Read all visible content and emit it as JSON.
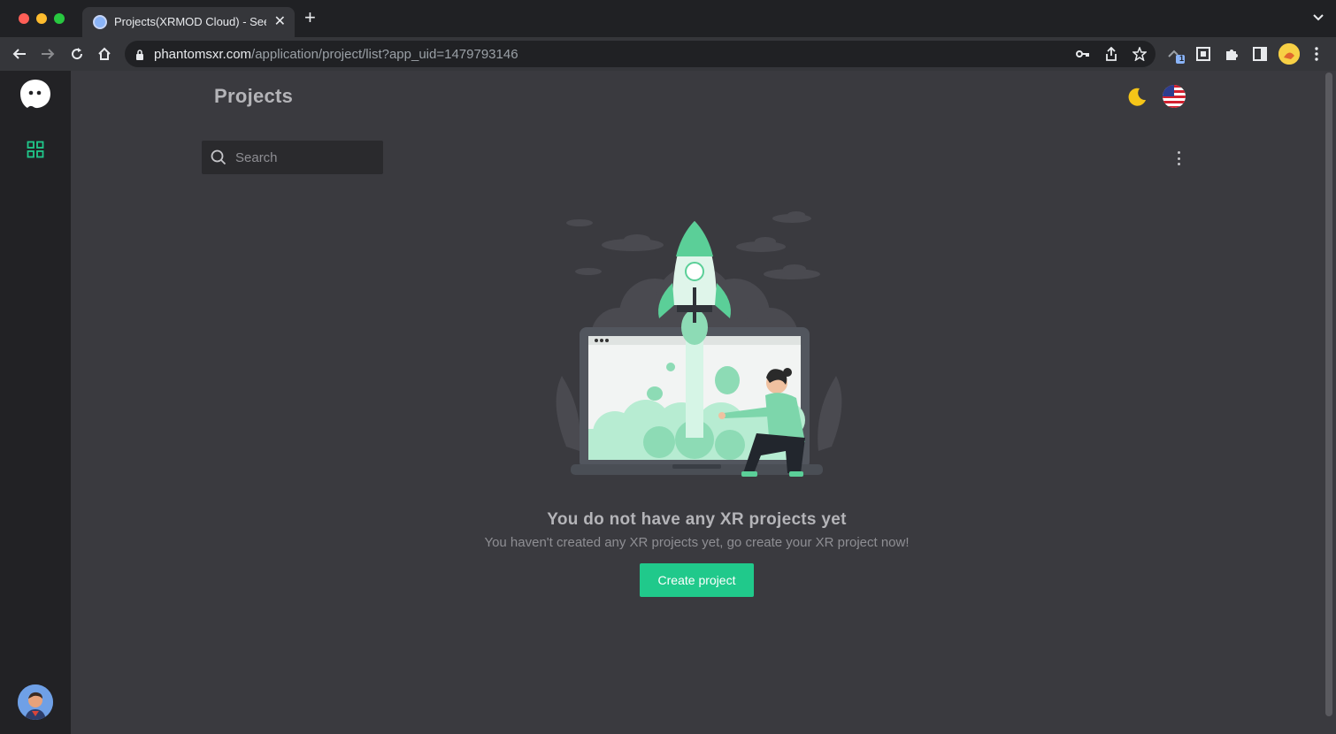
{
  "browser": {
    "tab_title": "Projects(XRMOD Cloud) - See",
    "url_host": "phantomsxr.com",
    "url_path": "/application/project/list?app_uid=1479793146",
    "extension_badge": "1"
  },
  "app": {
    "page_title": "Projects",
    "search_placeholder": "Search",
    "empty_state": {
      "title": "You do not have any XR projects yet",
      "subtitle": "You haven't created any XR projects yet, go create your XR project now!",
      "button_label": "Create project"
    },
    "colors": {
      "accent": "#20c98b",
      "sidebar": "#222225",
      "background": "#3a3a3f"
    },
    "icons": [
      "ghost-logo-icon",
      "grid-icon",
      "moon-icon",
      "us-flag-icon",
      "search-icon",
      "more-vertical-icon"
    ]
  }
}
